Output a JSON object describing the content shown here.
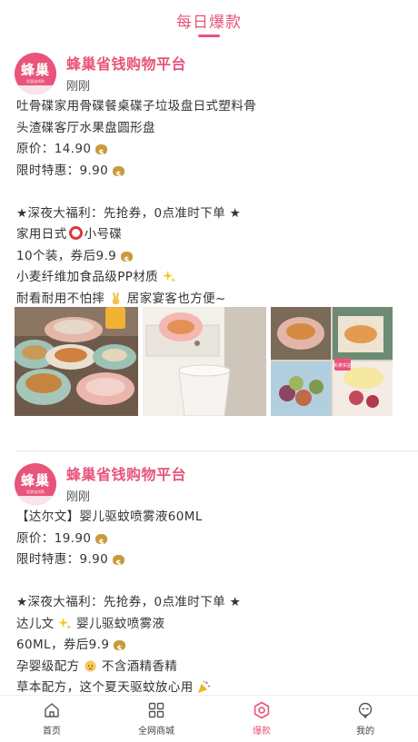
{
  "header": {
    "title": "每日爆款"
  },
  "posts": [
    {
      "logo_text": "蜂巢",
      "logo_sub": "智惠省钱购",
      "shop_name": "蜂巢省钱购物平台",
      "time": "刚刚",
      "title_line1": "吐骨碟家用骨碟餐桌碟子垃圾盘日式塑料骨",
      "title_line2": "头渣碟客厅水果盘圆形盘",
      "original_price": "原价：14.90",
      "special_price": "限时特惠：9.90",
      "promo": "★深夜大福利：先抢券，0点准时下单 ★",
      "line_a_pre": "家用日式",
      "line_a_post": "小号碟",
      "line_b": "10个装，券后9.9",
      "line_c": "小麦纤维加食品级PP材质",
      "line_d_pre": "耐看耐用不怕摔",
      "line_d_post": "居家宴客也方便~",
      "photo_badge": "实拿实拍"
    },
    {
      "logo_text": "蜂巢",
      "logo_sub": "智惠省钱购",
      "shop_name": "蜂巢省钱购物平台",
      "time": "刚刚",
      "title_line1": "【达尔文】婴儿驱蚊喷雾液60ML",
      "original_price": "原价：19.90",
      "special_price": "限时特惠：9.90",
      "promo": "★深夜大福利：先抢券，0点准时下单 ★",
      "line_a_pre": "达儿文",
      "line_a_post": "婴儿驱蚊喷雾液",
      "line_b": "60ML，券后9.9",
      "line_c_pre": "孕婴级配方",
      "line_c_post": "不含酒精香精",
      "line_d": "草本配方，这个夏天驱蚊放心用"
    }
  ],
  "tabs": [
    {
      "label": "首页",
      "icon": "home-icon"
    },
    {
      "label": "全网商城",
      "icon": "grid-icon"
    },
    {
      "label": "爆款",
      "icon": "hot-icon"
    },
    {
      "label": "我的",
      "icon": "profile-icon"
    }
  ],
  "colors": {
    "accent": "#e8547a",
    "text": "#333333",
    "muted": "#555555"
  }
}
